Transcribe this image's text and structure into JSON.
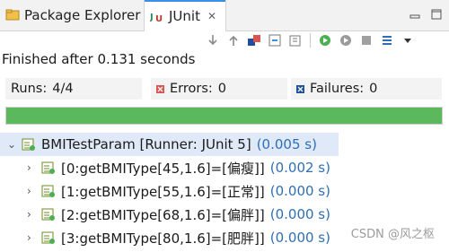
{
  "tabs": {
    "package_explorer": "Package Explorer",
    "junit": "JUnit",
    "junit_close": "✕"
  },
  "toolbar": {
    "icons": [
      "next-failure-icon",
      "previous-failure-icon",
      "show-failures-only-icon",
      "scroll-lock-icon",
      "history-icon",
      "rerun-icon",
      "rerun-failed-first-icon",
      "stop-icon",
      "layout-icon",
      "view-menu-icon",
      "minimize-icon",
      "maximize-icon"
    ]
  },
  "status": {
    "text": "Finished after 0.131 seconds"
  },
  "counters": {
    "runs_label": "Runs:",
    "runs_value": "4/4",
    "errors_label": "Errors:",
    "errors_value": "0",
    "failures_label": "Failures:",
    "failures_value": "0"
  },
  "progress": {
    "fraction": 1.0,
    "color": "#5cb85c"
  },
  "tree": {
    "root": {
      "label": "BMITestParam [Runner: JUnit 5]",
      "time": "(0.005 s)"
    },
    "children": [
      {
        "label": "[0:getBMIType[45,1.6]=[偏瘦]]",
        "time": "(0.002 s)"
      },
      {
        "label": "[1:getBMIType[55,1.6]=[正常]]",
        "time": "(0.000 s)"
      },
      {
        "label": "[2:getBMIType[68,1.6]=[偏胖]]",
        "time": "(0.000 s)"
      },
      {
        "label": "[3:getBMIType[80,1.6]=[肥胖]]",
        "time": "(0.000 s)"
      }
    ]
  },
  "watermark": "CSDN @风之枢"
}
